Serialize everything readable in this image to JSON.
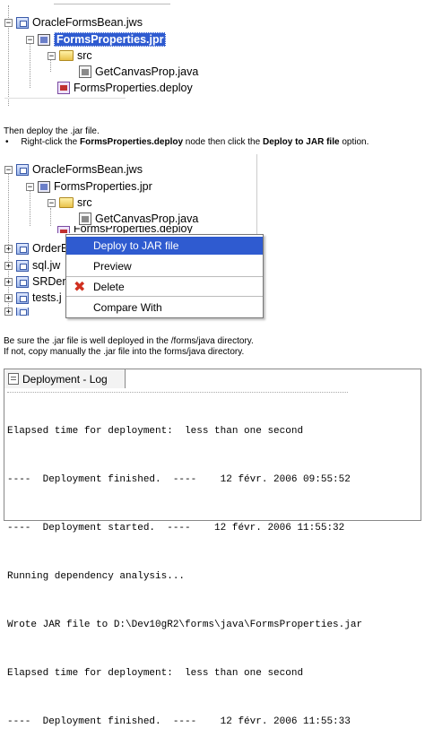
{
  "tree1": {
    "rows": [
      {
        "label": "OracleFormsBean.jws"
      },
      {
        "label": "FormsProperties.jpr"
      },
      {
        "label": "src"
      },
      {
        "label": "GetCanvasProp.java"
      },
      {
        "label": "FormsProperties.deploy"
      }
    ]
  },
  "instructions": {
    "line1": "Then deploy the .jar file.",
    "bullet_prefix": "Right-click the ",
    "bullet_node": "FormsProperties.deploy",
    "bullet_mid": " node then click the ",
    "bullet_option": "Deploy to JAR file",
    "bullet_suffix": " option."
  },
  "tree2": {
    "rows": [
      {
        "label": "OracleFormsBean.jws"
      },
      {
        "label": "FormsProperties.jpr"
      },
      {
        "label": "src"
      },
      {
        "label": "GetCanvasProp.java"
      },
      {
        "label": "FormsProperties.deploy"
      }
    ],
    "partial": [
      "OrderE",
      "sql.jw",
      "SRDer",
      "tests.j"
    ]
  },
  "context_menu": {
    "items": [
      {
        "label": "Deploy to JAR file"
      },
      {
        "label": "Preview"
      },
      {
        "label": "Delete"
      },
      {
        "label": "Compare With"
      }
    ]
  },
  "notes": {
    "line1": "Be sure the .jar file is well deployed in the /forms/java directory.",
    "line2": "If not, copy manually the .jar file into the forms/java directory."
  },
  "log": {
    "tab_label": "Deployment - Log",
    "lines": [
      "Elapsed time for deployment:  less than one second",
      "----  Deployment finished.  ----    12 févr. 2006 09:55:52",
      "----  Deployment started.  ----    12 févr. 2006 11:55:32",
      "Running dependency analysis...",
      "Wrote JAR file to D:\\Dev10gR2\\forms\\java\\FormsProperties.jar",
      "Elapsed time for deployment:  less than one second",
      "----  Deployment finished.  ----    12 févr. 2006 11:55:33"
    ]
  },
  "colors": {
    "selection": "#2f5bd0",
    "delete_icon": "#d03020"
  }
}
